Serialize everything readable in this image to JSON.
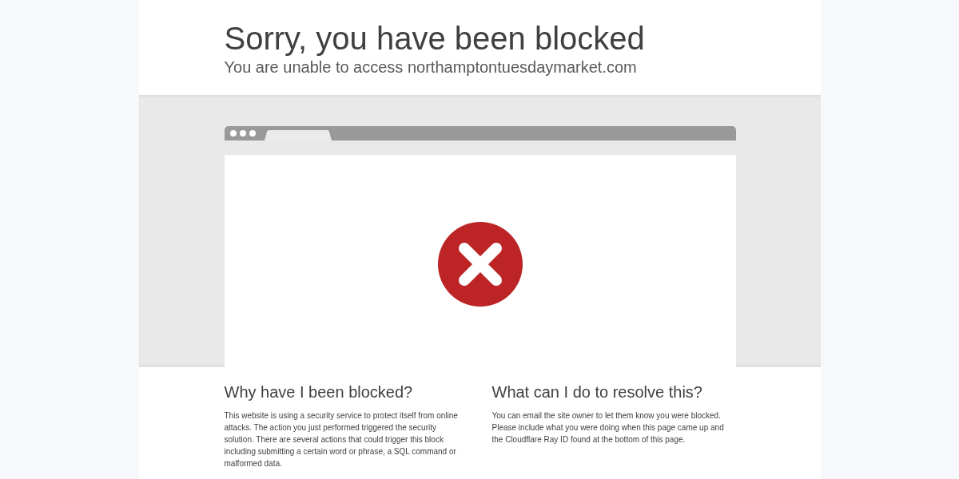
{
  "header": {
    "title": "Sorry, you have been blocked",
    "subtitle": "You are unable to access northamptontuesdaymarket.com"
  },
  "sections": [
    {
      "heading": "Why have I been blocked?",
      "body": "This website is using a security service to protect itself from online attacks. The action you just performed triggered the security solution. There are several actions that could trigger this block including submitting a certain word or phrase, a SQL command or malformed data."
    },
    {
      "heading": "What can I do to resolve this?",
      "body": "You can email the site owner to let them know you were blocked. Please include what you were doing when this page came up and the Cloudflare Ray ID found at the bottom of this page."
    }
  ]
}
